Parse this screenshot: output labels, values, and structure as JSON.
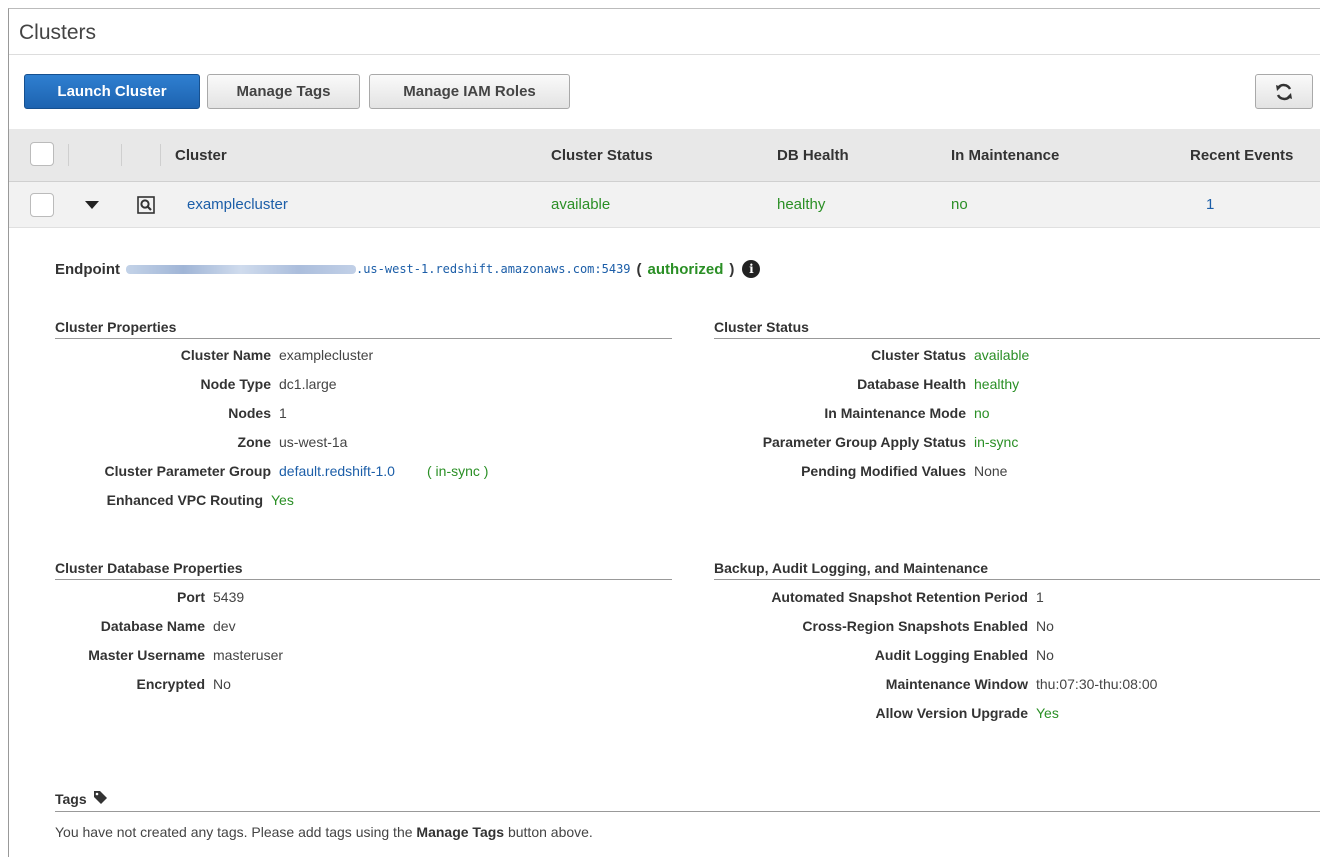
{
  "page": {
    "title": "Clusters"
  },
  "toolbar": {
    "launch": "Launch Cluster",
    "manage_tags": "Manage Tags",
    "manage_iam": "Manage IAM Roles",
    "refresh_icon": "refresh-icon"
  },
  "table": {
    "headers": {
      "cluster": "Cluster",
      "status": "Cluster Status",
      "health": "DB Health",
      "maintenance": "In Maintenance",
      "events": "Recent Events"
    },
    "row": {
      "name": "examplecluster",
      "status": "available",
      "health": "healthy",
      "maintenance": "no",
      "events": "1"
    }
  },
  "detail": {
    "endpoint_label": "Endpoint",
    "endpoint_suffix": ".us-west-1.redshift.amazonaws.com:5439",
    "paren_open": "(",
    "authorized": "authorized",
    "paren_close": ")",
    "info_icon": "i",
    "cluster_properties": {
      "title": "Cluster Properties",
      "cluster_name_k": "Cluster Name",
      "cluster_name_v": "examplecluster",
      "node_type_k": "Node Type",
      "node_type_v": "dc1.large",
      "nodes_k": "Nodes",
      "nodes_v": "1",
      "zone_k": "Zone",
      "zone_v": "us-west-1a",
      "param_group_k": "Cluster Parameter Group",
      "param_group_v": "default.redshift-1.0",
      "param_group_status": "( in-sync )",
      "vpc_k": "Enhanced VPC Routing",
      "vpc_v": "Yes"
    },
    "cluster_status": {
      "title": "Cluster Status",
      "status_k": "Cluster Status",
      "status_v": "available",
      "health_k": "Database Health",
      "health_v": "healthy",
      "maint_k": "In Maintenance Mode",
      "maint_v": "no",
      "param_k": "Parameter Group Apply Status",
      "param_v": "in-sync",
      "pending_k": "Pending Modified Values",
      "pending_v": "None"
    },
    "db_properties": {
      "title": "Cluster Database Properties",
      "port_k": "Port",
      "port_v": "5439",
      "dbname_k": "Database Name",
      "dbname_v": "dev",
      "user_k": "Master Username",
      "user_v": "masteruser",
      "enc_k": "Encrypted",
      "enc_v": "No"
    },
    "backup": {
      "title": "Backup, Audit Logging, and Maintenance",
      "retention_k": "Automated Snapshot Retention Period",
      "retention_v": "1",
      "cross_k": "Cross-Region Snapshots Enabled",
      "cross_v": "No",
      "audit_k": "Audit Logging Enabled",
      "audit_v": "No",
      "window_k": "Maintenance Window",
      "window_v": "thu:07:30-thu:08:00",
      "upgrade_k": "Allow Version Upgrade",
      "upgrade_v": "Yes"
    },
    "tags": {
      "title": "Tags",
      "msg_pre": "You have not created any tags. Please add tags using the ",
      "msg_bold": "Manage Tags",
      "msg_post": " button above."
    }
  }
}
